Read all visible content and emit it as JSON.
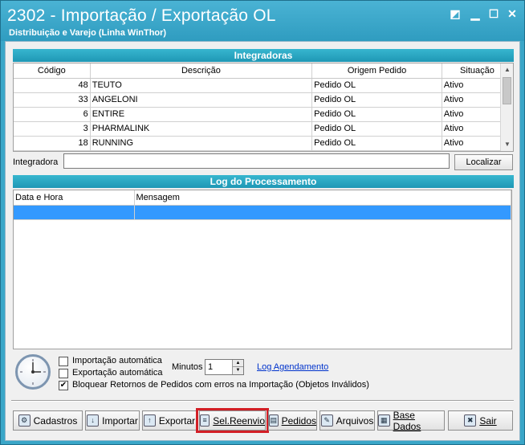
{
  "window": {
    "title": "2302 - Importação / Exportação OL",
    "subtitle": "Distribuição e Varejo (Linha WinThor)",
    "controls": [
      "◩",
      "▁",
      "☐",
      "✕"
    ]
  },
  "integradoras": {
    "header": "Integradoras",
    "columns": [
      "Código",
      "Descrição",
      "Origem Pedido",
      "Situação"
    ],
    "rows": [
      {
        "codigo": "48",
        "descricao": "TEUTO",
        "origem": "Pedido OL",
        "situacao": "Ativo"
      },
      {
        "codigo": "33",
        "descricao": "ANGELONI",
        "origem": "Pedido OL",
        "situacao": "Ativo"
      },
      {
        "codigo": "6",
        "descricao": "ENTIRE",
        "origem": "Pedido OL",
        "situacao": "Ativo"
      },
      {
        "codigo": "3",
        "descricao": "PHARMALINK",
        "origem": "Pedido OL",
        "situacao": "Ativo"
      },
      {
        "codigo": "18",
        "descricao": "RUNNING",
        "origem": "Pedido OL",
        "situacao": "Ativo"
      }
    ]
  },
  "search": {
    "label": "Integradora",
    "value": "",
    "button": "Localizar"
  },
  "log": {
    "header": "Log do Processamento",
    "columns": [
      "Data e Hora",
      "Mensagem"
    ]
  },
  "options": {
    "import_auto": "Importação automática",
    "export_auto": "Exportação automática",
    "block_returns": "Bloquear Retornos de Pedidos com erros na Importação (Objetos Inválidos)",
    "import_checked": false,
    "export_checked": false,
    "block_checked": true,
    "minutes_label": "Minutos",
    "minutes_value": "1",
    "log_link": "Log Agendamento"
  },
  "toolbar": {
    "cadastros": "Cadastros",
    "importar": "Importar",
    "exportar": "Exportar",
    "sel_reenvio": "Sel.Reenvio",
    "pedidos": "Pedidos",
    "arquivos": "Arquivos",
    "base_dados": "Base Dados",
    "sair": "Sair"
  },
  "colors": {
    "title_bg": "#3aa6c8",
    "section_header": "#27a3c0",
    "selection": "#3399ff",
    "highlight": "#d21f26"
  }
}
